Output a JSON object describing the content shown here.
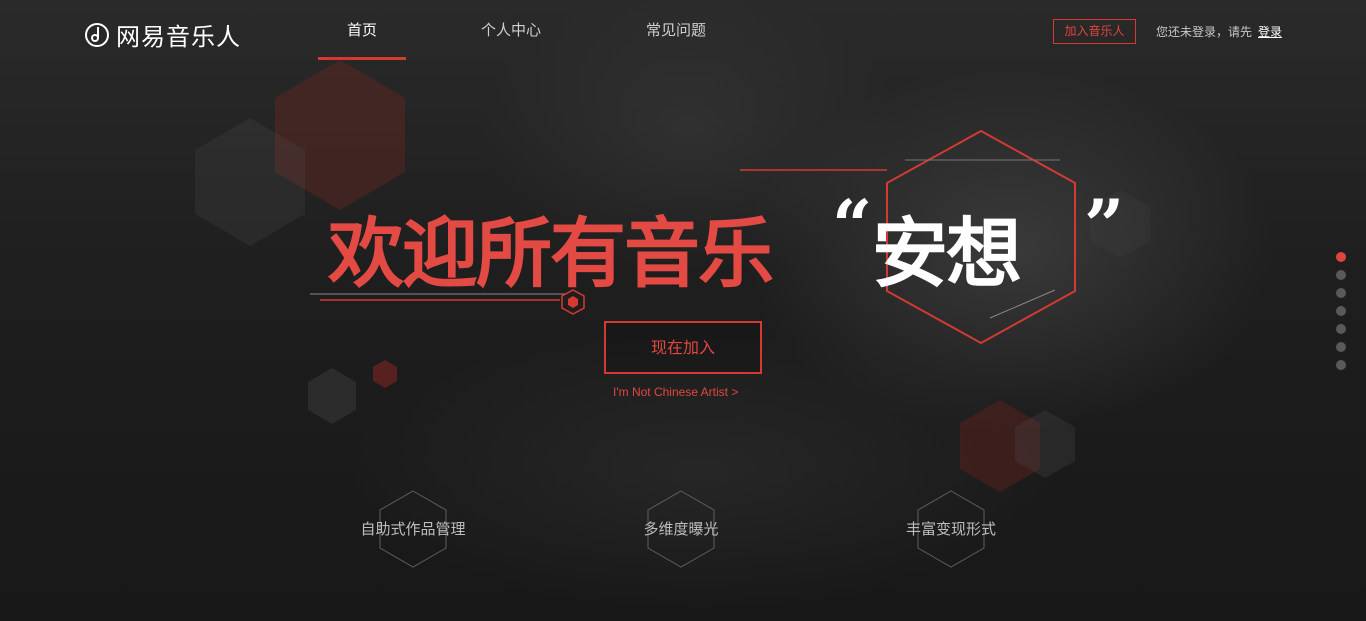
{
  "header": {
    "logo_text": "网易音乐人",
    "nav": [
      {
        "label": "首页",
        "active": true
      },
      {
        "label": "个人中心",
        "active": false
      },
      {
        "label": "常见问题",
        "active": false
      }
    ],
    "join_button": "加入音乐人",
    "login_hint": "您还未登录，请先",
    "login_link": "登录"
  },
  "hero": {
    "slogan_red": "欢迎所有音乐",
    "quote_open": "“",
    "slogan_white": "安想",
    "quote_close": "”",
    "cta_button": "现在加入",
    "not_chinese_link": "I'm Not Chinese Artist >"
  },
  "features": [
    {
      "label": "自助式作品管理"
    },
    {
      "label": "多维度曝光"
    },
    {
      "label": "丰富变现形式"
    }
  ],
  "pager": {
    "count": 7,
    "active_index": 0
  },
  "colors": {
    "accent": "#d33a31",
    "text_light": "#cfcfcf",
    "background": "#1c1c1c"
  }
}
